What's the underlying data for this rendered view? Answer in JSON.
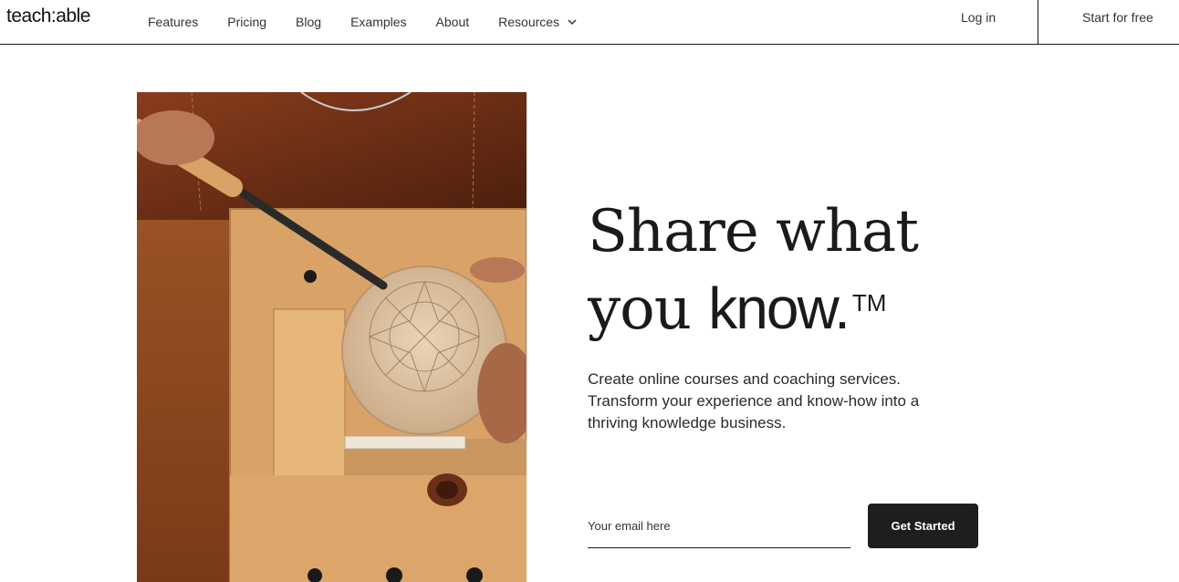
{
  "nav": {
    "logo": "teach:able",
    "links": [
      "Features",
      "Pricing",
      "Blog",
      "Examples",
      "About",
      "Resources"
    ],
    "login": "Log in",
    "start_free": "Start for free"
  },
  "hero": {
    "headline_line1": "Share what",
    "headline_line2_serif": "you ",
    "headline_line2_sans": "know.",
    "trademark": "TM",
    "subtext": "Create online courses and coaching services. Transform your experience and know-how into a thriving knowledge business.",
    "email_placeholder": "Your email here",
    "cta_label": "Get Started",
    "image_icon": "wood-carving-photo"
  },
  "colors": {
    "dark": "#1e1e1e",
    "text": "#1a1a1a"
  }
}
